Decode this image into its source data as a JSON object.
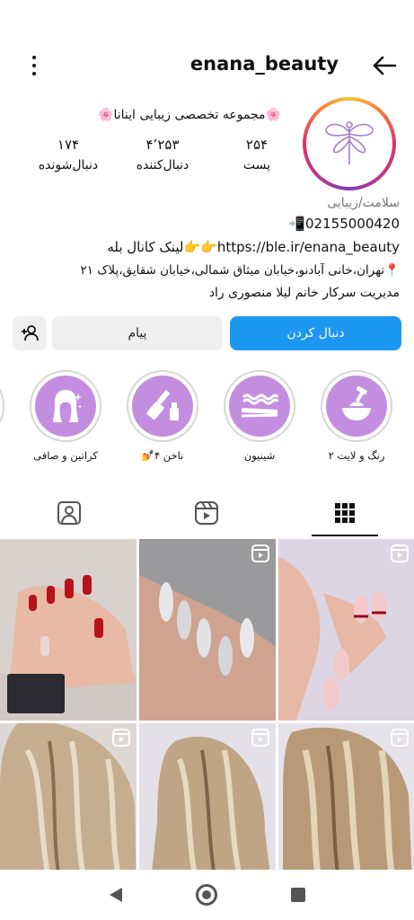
{
  "header": {
    "username": "enana_beauty"
  },
  "profile": {
    "bio_title": "🌸مجموعه تخصصی زیبایی اینانا🌸",
    "stats": [
      {
        "value": "۲۵۴",
        "label": "پست"
      },
      {
        "value": "۴٬۲۵۳",
        "label": "دنبال‌کننده"
      },
      {
        "value": "۱۷۴",
        "label": "دنبال‌شونده"
      }
    ],
    "category": "سلامت/زیبایی",
    "phone": "02155000420📲",
    "link": "https://ble.ir/enana_beauty👉👉لینک کانال بله",
    "address": "📍تهران،خانی آبادنو،خیابان میثاق شمالی،خیابان شقایق،پلاک ۲۱",
    "manager": "مدیریت سرکار خانم لیلا منصوری راد"
  },
  "buttons": {
    "follow": "دنبال کردن",
    "message": "پیام"
  },
  "highlights": [
    {
      "label": "رنگ و لایت ۲",
      "icon": "hair-dye-bowl-icon"
    },
    {
      "label": "شینیون",
      "icon": "hair-clips-icon"
    },
    {
      "label": "ناخن ۴💅",
      "icon": "nail-polish-icon"
    },
    {
      "label": "کراتین و صافی",
      "icon": "woman-hair-icon"
    }
  ],
  "colors": {
    "accent": "#1c97f2",
    "highlight_bg": "#c48ee0",
    "button_gray": "#efefef"
  }
}
